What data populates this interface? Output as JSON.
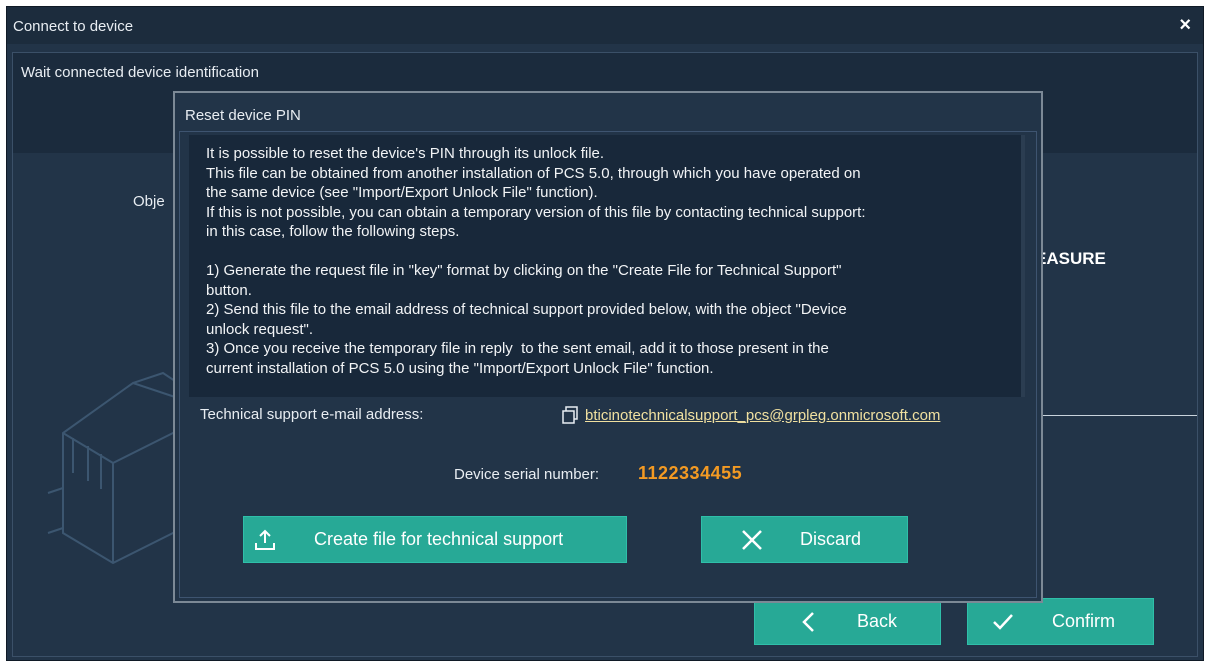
{
  "window": {
    "title": "Connect to device",
    "close_symbol": "×"
  },
  "background": {
    "wait_text": "Wait connected device  identification",
    "object_label": "Obje",
    "measure_label": "EASURE",
    "back_label": "Back",
    "confirm_label": "Confirm"
  },
  "dialog": {
    "title": "Reset device PIN",
    "info_lines": [
      "It is possible to reset the device's PIN through its unlock file.",
      "This file can be obtained from another installation of PCS 5.0, through which you have operated on",
      "the same device (see \"Import/Export Unlock File\" function).",
      "If this is not possible, you can obtain a temporary version of this file by contacting technical support:",
      "in this case, follow the following steps.",
      "",
      "1) Generate the request file in \"key\" format by clicking on the \"Create File for Technical Support\"",
      "button.",
      "2) Send this file to the email address of technical support provided below, with the object \"Device",
      "unlock request\".",
      "3) Once you receive the temporary file in reply  to the sent email, add it to those present in the",
      "current installation of PCS 5.0 using the \"Import/Export Unlock File\" function."
    ],
    "email_label": "Technical support e-mail address:",
    "email": "bticinotechnicalsupport_pcs@grpleg.onmicrosoft.com",
    "serial_label": "Device serial number:",
    "serial_value": "1122334455",
    "create_label": "Create file for technical support",
    "discard_label": "Discard"
  },
  "colors": {
    "background": "#223448",
    "button": "#27a996",
    "serial": "#f39a23",
    "link": "#f0e0a0"
  },
  "icons": [
    "close-icon",
    "back-chevron-icon",
    "confirm-check-icon",
    "copy-icon",
    "upload-icon",
    "discard-x-icon"
  ]
}
